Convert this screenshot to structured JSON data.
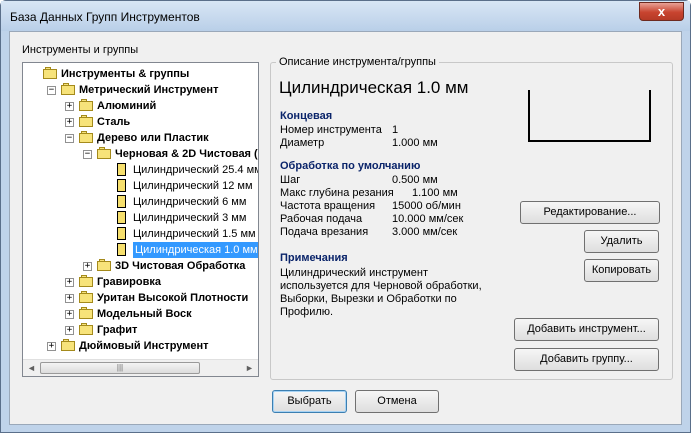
{
  "window": {
    "title": "База Данных Групп Инструментов",
    "close_glyph": "x"
  },
  "tree": {
    "group_label": "Инструменты и группы",
    "nodes": [
      {
        "label": "Инструменты & группы",
        "expander": "",
        "bold": true
      },
      {
        "label": "Метрический Инструмент",
        "expander": "−",
        "bold": true
      },
      {
        "label": "Алюминий",
        "expander": "+",
        "bold": true
      },
      {
        "label": "Сталь",
        "expander": "+",
        "bold": true
      },
      {
        "label": "Дерево или Пластик",
        "expander": "−",
        "bold": true
      },
      {
        "label": "Черновая & 2D Чистовая (",
        "expander": "−",
        "bold": true
      },
      {
        "label": "Цилиндрический 25.4 мм",
        "expander": "",
        "bold": false
      },
      {
        "label": "Цилиндрический 12 мм",
        "expander": "",
        "bold": false
      },
      {
        "label": "Цилиндрический 6 мм",
        "expander": "",
        "bold": false
      },
      {
        "label": "Цилиндрический 3 мм",
        "expander": "",
        "bold": false
      },
      {
        "label": "Цилиндрический 1.5 мм",
        "expander": "",
        "bold": false
      },
      {
        "label": "Цилиндрическая 1.0 мм",
        "expander": "",
        "bold": false,
        "selected": true
      },
      {
        "label": "3D Чистовая Обработка",
        "expander": "+",
        "bold": true
      },
      {
        "label": "Гравировка",
        "expander": "+",
        "bold": true
      },
      {
        "label": "Уритан Высокой Плотности",
        "expander": "+",
        "bold": true
      },
      {
        "label": "Модельный Воск",
        "expander": "+",
        "bold": true
      },
      {
        "label": "Графит",
        "expander": "+",
        "bold": true
      },
      {
        "label": "Дюймовый Инструмент",
        "expander": "+",
        "bold": true
      }
    ],
    "scroll_left": "◄",
    "scroll_right": "►",
    "scroll_thumb_grip": "|||"
  },
  "description": {
    "legend": "Описание инструмента/группы",
    "tool_name": "Цилиндрическая 1.0 мм",
    "type_heading": "Концевая",
    "tool_number_label": "Номер инструмента",
    "tool_number_value": "1",
    "diameter_label": "Диаметр",
    "diameter_value": "1.000 мм",
    "defaults_heading": "Обработка по умолчанию",
    "stepover_label": "Шаг",
    "stepover_value": "0.500 мм",
    "depth_label": "Макс глубина резания",
    "depth_value": "1.100 мм",
    "spindle_label": "Частота вращения",
    "spindle_value": "15000 об/мин",
    "feed_label": "Рабочая подача",
    "feed_value": "10.000 мм/сек",
    "plunge_label": "Подача врезания",
    "plunge_value": "3.000 мм/сек",
    "notes_heading": "Примечания",
    "notes_text": "Цилиндрический инструмент используется для Черновой обработки, Выборки, Вырезки и Обработки по Профилю."
  },
  "buttons": {
    "edit": "Редактирование...",
    "delete": "Удалить",
    "copy": "Копировать",
    "add_tool": "Добавить инструмент...",
    "add_group": "Добавить группу...",
    "select": "Выбрать",
    "cancel": "Отмена"
  }
}
